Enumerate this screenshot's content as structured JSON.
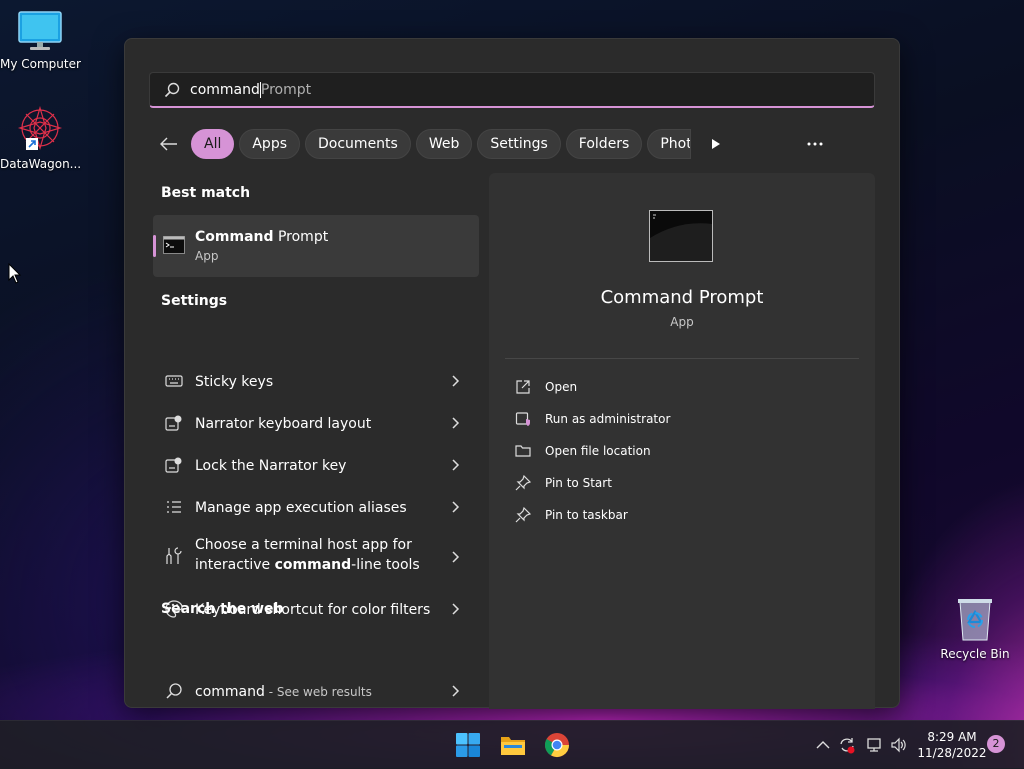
{
  "desktop": {
    "icons": [
      {
        "label": "My Computer"
      },
      {
        "label": "DataWagon..."
      },
      {
        "label": "Recycle Bin"
      }
    ]
  },
  "search": {
    "typed": "command",
    "suggestion": "Prompt"
  },
  "filters": [
    {
      "label": "All",
      "active": true
    },
    {
      "label": "Apps"
    },
    {
      "label": "Documents"
    },
    {
      "label": "Web"
    },
    {
      "label": "Settings"
    },
    {
      "label": "Folders"
    },
    {
      "label": "Photos"
    }
  ],
  "best_match": {
    "section_title": "Best match",
    "name_bold": "Command",
    "name_rest": " Prompt",
    "type": "App"
  },
  "settings": {
    "section_title": "Settings",
    "items": [
      {
        "label": "Sticky keys"
      },
      {
        "label": "Narrator keyboard layout"
      },
      {
        "label": "Lock the Narrator key"
      },
      {
        "label": "Manage app execution aliases"
      },
      {
        "line1": "Choose a terminal host app for",
        "line2_pre": "interactive ",
        "line2_bold": "command",
        "line2_post": "-line tools"
      },
      {
        "label": "Keyboard shortcut for color filters"
      }
    ]
  },
  "web": {
    "section_title": "Search the web",
    "query": "command",
    "suffix": " - See web results"
  },
  "detail": {
    "title": "Command Prompt",
    "type": "App",
    "actions": [
      {
        "label": "Open",
        "icon": "open-icon"
      },
      {
        "label": "Run as administrator",
        "icon": "shield-icon"
      },
      {
        "label": "Open file location",
        "icon": "folder-icon"
      },
      {
        "label": "Pin to Start",
        "icon": "pin-icon"
      },
      {
        "label": "Pin to taskbar",
        "icon": "pin-icon"
      }
    ]
  },
  "taskbar": {
    "time": "8:29 AM",
    "date": "11/28/2022",
    "notifications": "2"
  },
  "colors": {
    "accent": "#d693d6",
    "panel": "#2b2b2b"
  }
}
